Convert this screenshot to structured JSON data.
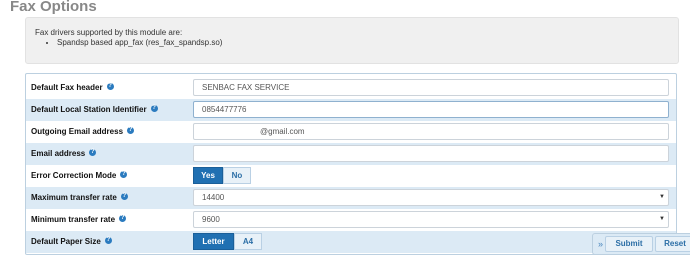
{
  "page_title": "Fax Options",
  "info": {
    "intro": "Fax drivers supported by this module are:",
    "drivers": [
      "Spandsp based app_fax (res_fax_spandsp.so)"
    ]
  },
  "fields": {
    "fax_header": {
      "label": "Default Fax header",
      "value": "SENBAC FAX SERVICE"
    },
    "station_id": {
      "label": "Default Local Station Identifier",
      "value": "0854477776"
    },
    "outgoing_email": {
      "label": "Outgoing Email address",
      "value": "@gmail.com"
    },
    "email": {
      "label": "Email address",
      "value": ""
    },
    "ecm": {
      "label": "Error Correction Mode",
      "options": [
        "Yes",
        "No"
      ],
      "selected": "Yes"
    },
    "max_rate": {
      "label": "Maximum transfer rate",
      "value": "14400"
    },
    "min_rate": {
      "label": "Minimum transfer rate",
      "value": "9600"
    },
    "paper_size": {
      "label": "Default Paper Size",
      "options": [
        "Letter",
        "A4"
      ],
      "selected": "Letter"
    }
  },
  "help_icon_glyph": "?",
  "actions": {
    "collapse_glyph": "»",
    "submit": "Submit",
    "reset": "Reset"
  },
  "colors": {
    "accent": "#2070b2",
    "row_alt": "#dceaf5",
    "title": "#888888"
  }
}
